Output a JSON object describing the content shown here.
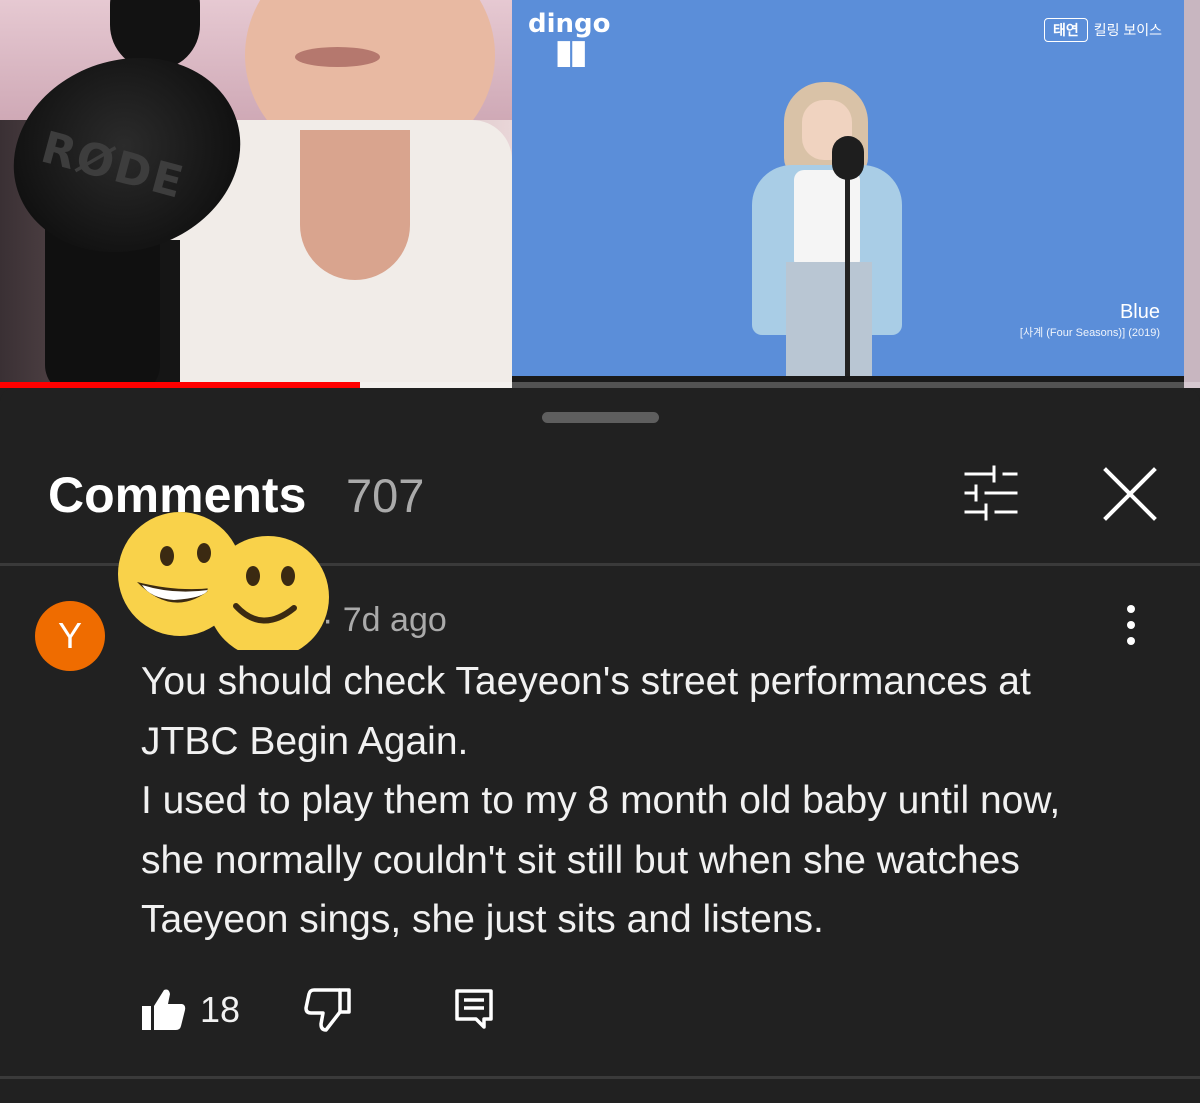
{
  "video": {
    "left_clip": {
      "brand": "RØDE"
    },
    "right_clip": {
      "channel_logo": "dingo",
      "badge": "킬링 보이스",
      "badge_box": "태연",
      "song_title": "Blue",
      "song_subtitle": "[사계 (Four Seasons)] (2019)"
    },
    "progress_fraction": 0.3
  },
  "comments": {
    "title": "Comments",
    "count": "707",
    "items": [
      {
        "avatar_letter": "Y",
        "avatar_color": "#ef6c00",
        "timestamp": "· 7d ago",
        "text": "You should check Taeyeon's street performances at\nJTBC Begin Again.\nI used to play them to my 8 month old baby until now,\nshe normally couldn't sit still but when she watches\nTaeyeon sings, she just sits and listens.",
        "likes": "18"
      }
    ]
  },
  "colors": {
    "panel_bg": "#212121",
    "secondary_text": "#aaaaaa",
    "progress": "#ff0000"
  }
}
